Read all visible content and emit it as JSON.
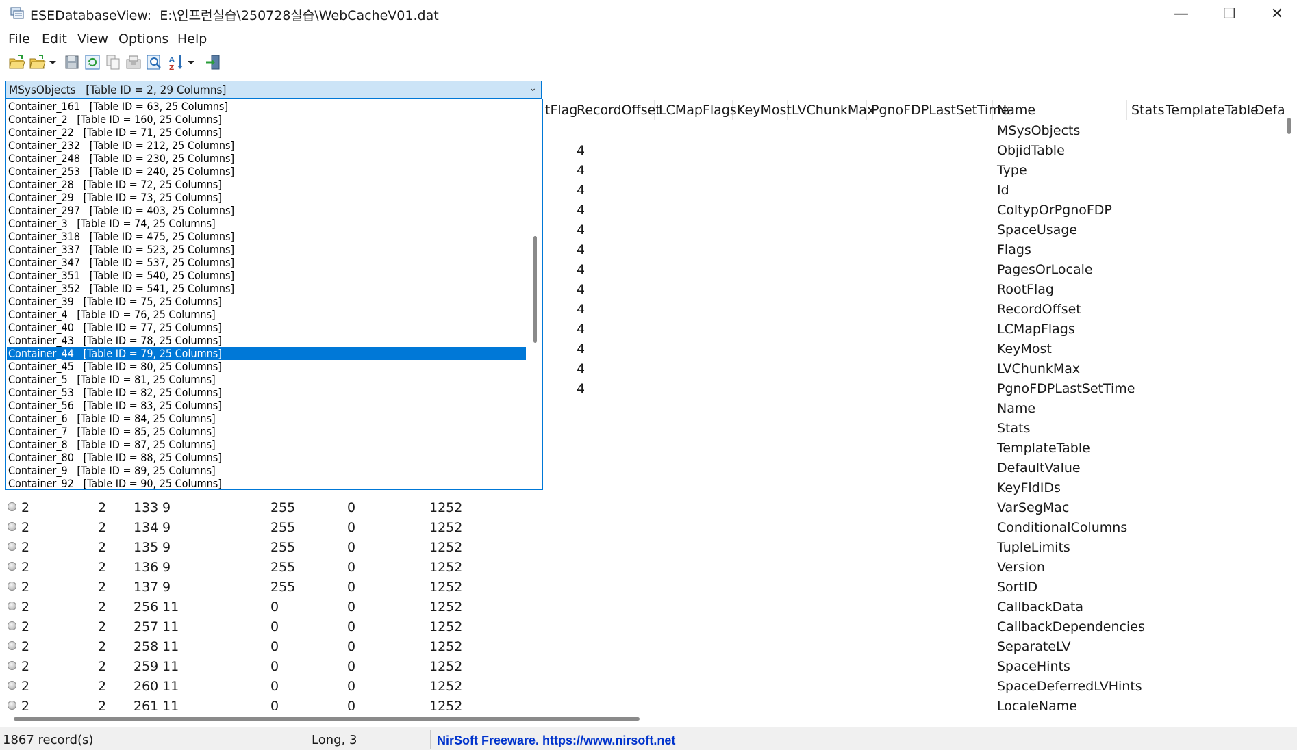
{
  "window": {
    "app_name": "ESEDatabaseView:",
    "file_path": "E:\\인프런실습\\250728실습\\WebCacheV01.dat",
    "minimize": "—",
    "maximize": "☐",
    "close": "✕"
  },
  "menu": [
    "File",
    "Edit",
    "View",
    "Options",
    "Help"
  ],
  "toolbar": {
    "icons": [
      "open-folder-icon",
      "open-folder-dropdown-icon",
      "save-icon",
      "refresh-icon",
      "copy-icon",
      "properties-icon",
      "find-icon",
      "sort-icon",
      "exit-icon"
    ]
  },
  "table_selector": {
    "selected": "MSysObjects   [Table ID = 2, 29 Columns]",
    "options": [
      "Container_161   [Table ID = 63, 25 Columns]",
      "Container_2   [Table ID = 160, 25 Columns]",
      "Container_22   [Table ID = 71, 25 Columns]",
      "Container_232   [Table ID = 212, 25 Columns]",
      "Container_248   [Table ID = 230, 25 Columns]",
      "Container_253   [Table ID = 240, 25 Columns]",
      "Container_28   [Table ID = 72, 25 Columns]",
      "Container_29   [Table ID = 73, 25 Columns]",
      "Container_297   [Table ID = 403, 25 Columns]",
      "Container_3   [Table ID = 74, 25 Columns]",
      "Container_318   [Table ID = 475, 25 Columns]",
      "Container_337   [Table ID = 523, 25 Columns]",
      "Container_347   [Table ID = 537, 25 Columns]",
      "Container_351   [Table ID = 540, 25 Columns]",
      "Container_352   [Table ID = 541, 25 Columns]",
      "Container_39   [Table ID = 75, 25 Columns]",
      "Container_4   [Table ID = 76, 25 Columns]",
      "Container_40   [Table ID = 77, 25 Columns]",
      "Container_43   [Table ID = 78, 25 Columns]",
      "Container_44   [Table ID = 79, 25 Columns]",
      "Container_45   [Table ID = 80, 25 Columns]",
      "Container_5   [Table ID = 81, 25 Columns]",
      "Container_53   [Table ID = 82, 25 Columns]",
      "Container_56   [Table ID = 83, 25 Columns]",
      "Container_6   [Table ID = 84, 25 Columns]",
      "Container_7   [Table ID = 85, 25 Columns]",
      "Container_8   [Table ID = 87, 25 Columns]",
      "Container_80   [Table ID = 88, 25 Columns]",
      "Container_9   [Table ID = 89, 25 Columns]",
      "Container_92   [Table ID = 90, 25 Columns]"
    ],
    "selected_option_index": 19
  },
  "grid": {
    "columns": [
      "tFlag",
      "RecordOffset",
      "LCMapFlags",
      "KeyMost",
      "LVChunkMax",
      "PgnoFDPLastSetTime",
      "Name",
      "Stats",
      "TemplateTable",
      "Defa"
    ],
    "upper_rows": [
      {
        "record_offset": "",
        "name": "MSysObjects"
      },
      {
        "record_offset": "4",
        "name": "ObjidTable"
      },
      {
        "record_offset": "4",
        "name": "Type"
      },
      {
        "record_offset": "4",
        "name": "Id"
      },
      {
        "record_offset": "4",
        "name": "ColtypOrPgnoFDP"
      },
      {
        "record_offset": "4",
        "name": "SpaceUsage"
      },
      {
        "record_offset": "4",
        "name": "Flags"
      },
      {
        "record_offset": "4",
        "name": "PagesOrLocale"
      },
      {
        "record_offset": "4",
        "name": "RootFlag"
      },
      {
        "record_offset": "4",
        "name": "RecordOffset"
      },
      {
        "record_offset": "4",
        "name": "LCMapFlags"
      },
      {
        "record_offset": "4",
        "name": "KeyMost"
      },
      {
        "record_offset": "4",
        "name": "LVChunkMax"
      },
      {
        "record_offset": "4",
        "name": "PgnoFDPLastSetTime"
      },
      {
        "record_offset": "",
        "name": "Name"
      },
      {
        "record_offset": "",
        "name": "Stats"
      },
      {
        "record_offset": "",
        "name": "TemplateTable"
      },
      {
        "record_offset": "",
        "name": "DefaultValue"
      },
      {
        "record_offset": "",
        "name": "KeyFldIDs"
      }
    ],
    "lower_rows": [
      {
        "c1": "2",
        "c2": "2",
        "c3": "133",
        "c4": "9",
        "c5": "255",
        "c6": "0",
        "c7": "1252",
        "name": "VarSegMac"
      },
      {
        "c1": "2",
        "c2": "2",
        "c3": "134",
        "c4": "9",
        "c5": "255",
        "c6": "0",
        "c7": "1252",
        "name": "ConditionalColumns"
      },
      {
        "c1": "2",
        "c2": "2",
        "c3": "135",
        "c4": "9",
        "c5": "255",
        "c6": "0",
        "c7": "1252",
        "name": "TupleLimits"
      },
      {
        "c1": "2",
        "c2": "2",
        "c3": "136",
        "c4": "9",
        "c5": "255",
        "c6": "0",
        "c7": "1252",
        "name": "Version"
      },
      {
        "c1": "2",
        "c2": "2",
        "c3": "137",
        "c4": "9",
        "c5": "255",
        "c6": "0",
        "c7": "1252",
        "name": "SortID"
      },
      {
        "c1": "2",
        "c2": "2",
        "c3": "256",
        "c4": "11",
        "c5": "0",
        "c6": "0",
        "c7": "1252",
        "name": "CallbackData"
      },
      {
        "c1": "2",
        "c2": "2",
        "c3": "257",
        "c4": "11",
        "c5": "0",
        "c6": "0",
        "c7": "1252",
        "name": "CallbackDependencies"
      },
      {
        "c1": "2",
        "c2": "2",
        "c3": "258",
        "c4": "11",
        "c5": "0",
        "c6": "0",
        "c7": "1252",
        "name": "SeparateLV"
      },
      {
        "c1": "2",
        "c2": "2",
        "c3": "259",
        "c4": "11",
        "c5": "0",
        "c6": "0",
        "c7": "1252",
        "name": "SpaceHints"
      },
      {
        "c1": "2",
        "c2": "2",
        "c3": "260",
        "c4": "11",
        "c5": "0",
        "c6": "0",
        "c7": "1252",
        "name": "SpaceDeferredLVHints"
      },
      {
        "c1": "2",
        "c2": "2",
        "c3": "261",
        "c4": "11",
        "c5": "0",
        "c6": "0",
        "c7": "1252",
        "name": "LocaleName"
      }
    ]
  },
  "status": {
    "records": "1867 record(s)",
    "type": "Long, 3",
    "link": "NirSoft Freeware. https://www.nirsoft.net"
  },
  "colors": {
    "accent": "#0078d7",
    "combo_bg": "#cce4f7",
    "link": "#0033cc"
  }
}
